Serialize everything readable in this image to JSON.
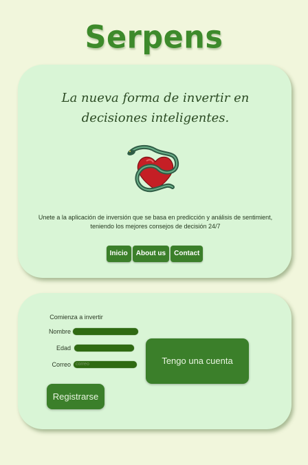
{
  "brand": {
    "title": "Serpens"
  },
  "hero": {
    "tagline": "La nueva forma de invertir en decisiones inteligentes.",
    "logo_icon": "snake-heart-icon",
    "description": "Unete a la aplicación de inversión que se basa en predicción y análisis de sentimient, teniendo los mejores consejos de decisión 24/7",
    "nav": [
      {
        "label": "Inicio"
      },
      {
        "label": "About us"
      },
      {
        "label": "Contact"
      }
    ]
  },
  "signup": {
    "title": "Comienza a invertir",
    "fields": {
      "name_label": "Nombre",
      "age_label": "Edad",
      "email_label": "Correo",
      "email_placeholder": "correo"
    },
    "register_label": "Registrarse",
    "account_label": "Tengo una cuenta"
  },
  "colors": {
    "background": "#f1f6dc",
    "card": "#d9f5d6",
    "accent": "#3b7f2a",
    "field": "#2f6a12"
  }
}
